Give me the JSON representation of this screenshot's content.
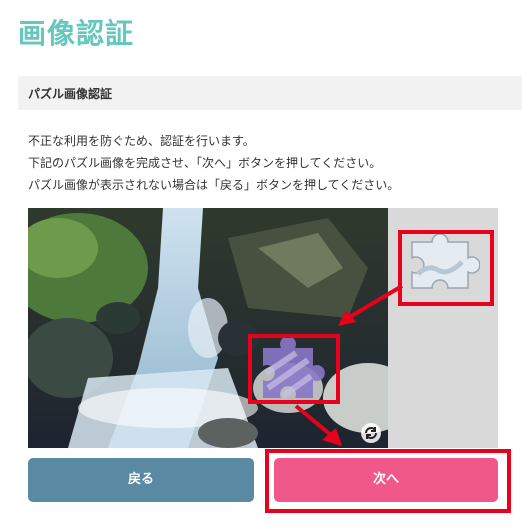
{
  "title": "画像認証",
  "section": {
    "label": "パズル画像認証"
  },
  "instructions": [
    "不正な利用を防ぐため、認証を行います。",
    "下記のパズル画像を完成させ、「次へ」ボタンを押してください。",
    "パズル画像が表示されない場合は「戻る」ボタンを押してください。"
  ],
  "puzzle": {
    "image_description": "waterfall-rocks-photo",
    "piece_icon": "puzzle-piece-icon",
    "target_icon": "puzzle-slot-icon",
    "refresh_icon": "refresh-icon"
  },
  "buttons": {
    "back_label": "戻る",
    "next_label": "次へ"
  },
  "colors": {
    "title": "#66c7bf",
    "back": "#5a8aa3",
    "next": "#f0588a",
    "highlight": "#e8001c"
  }
}
